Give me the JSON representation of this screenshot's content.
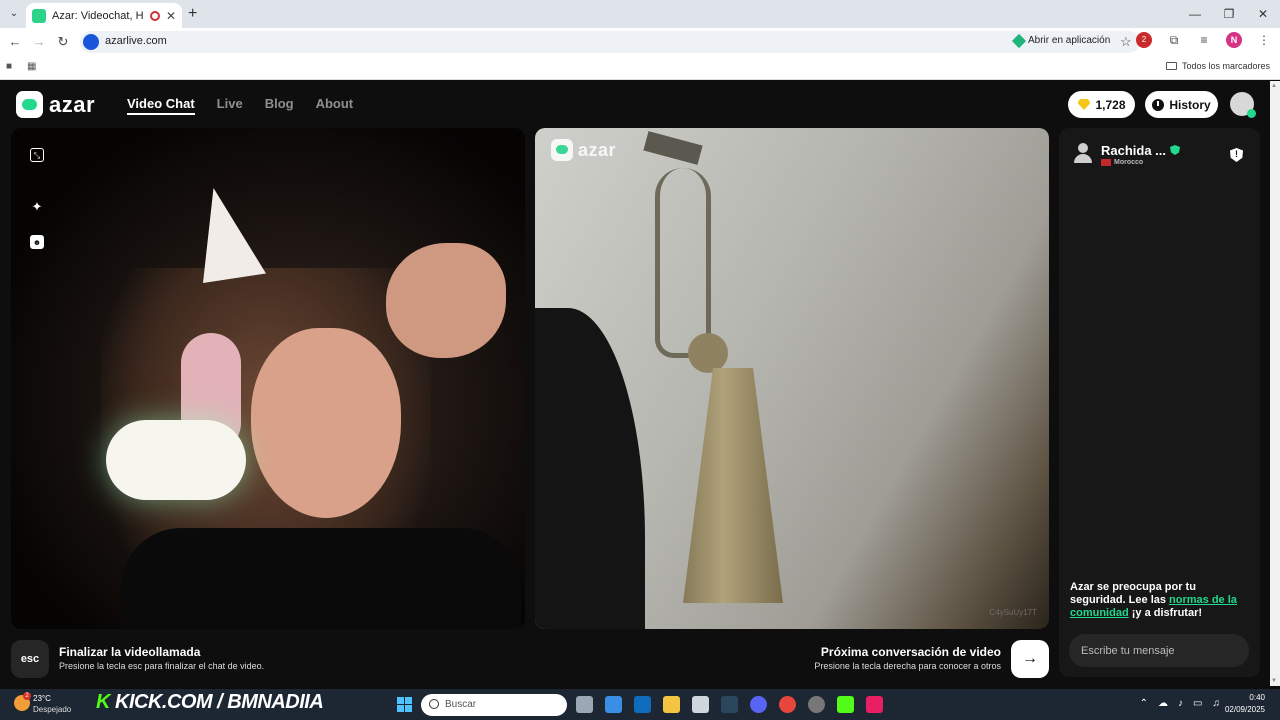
{
  "browser": {
    "tab_title": "Azar: Videochat, Haz nuevo",
    "url": "azarlive.com",
    "open_in_app": "Abrir en aplicación",
    "all_bookmarks": "Todos los marcadores",
    "profile_initial": "N",
    "extension_badge": "2"
  },
  "app": {
    "logo_text": "azar",
    "nav": [
      "Video Chat",
      "Live",
      "Blog",
      "About"
    ],
    "gems": "1,728",
    "history_label": "History"
  },
  "remote": {
    "watermark": "azar",
    "user_code": "C4ySuUy17T"
  },
  "chat": {
    "peer_name": "Rachida ...",
    "peer_country": "Morocco",
    "safety_pre": "Azar se preocupa por tu seguridad. Lee las ",
    "safety_link": "normas de la comunidad",
    "safety_post": " ¡y a disfrutar!",
    "input_placeholder": "Escribe tu mensaje"
  },
  "actions": {
    "esc_label": "esc",
    "end_title": "Finalizar la videollamada",
    "end_sub": "Presione la tecla esc para finalizar el chat de video.",
    "next_title": "Próxima conversación de video",
    "next_sub": "Presione la tecla derecha para conocer a otros",
    "next_arrow": "→"
  },
  "taskbar": {
    "temp": "23°C",
    "condition": "Despejado",
    "weather_badge": "2",
    "kick_k": "K",
    "kick_text": " KICK.COM / BMNADIIA",
    "search_placeholder": "Buscar",
    "time": "0:40",
    "date": "02/09/2025"
  },
  "colors": {
    "accent": "#20d98c",
    "app_bg": "#0e0e0e",
    "taskbar": "#1d2733"
  }
}
